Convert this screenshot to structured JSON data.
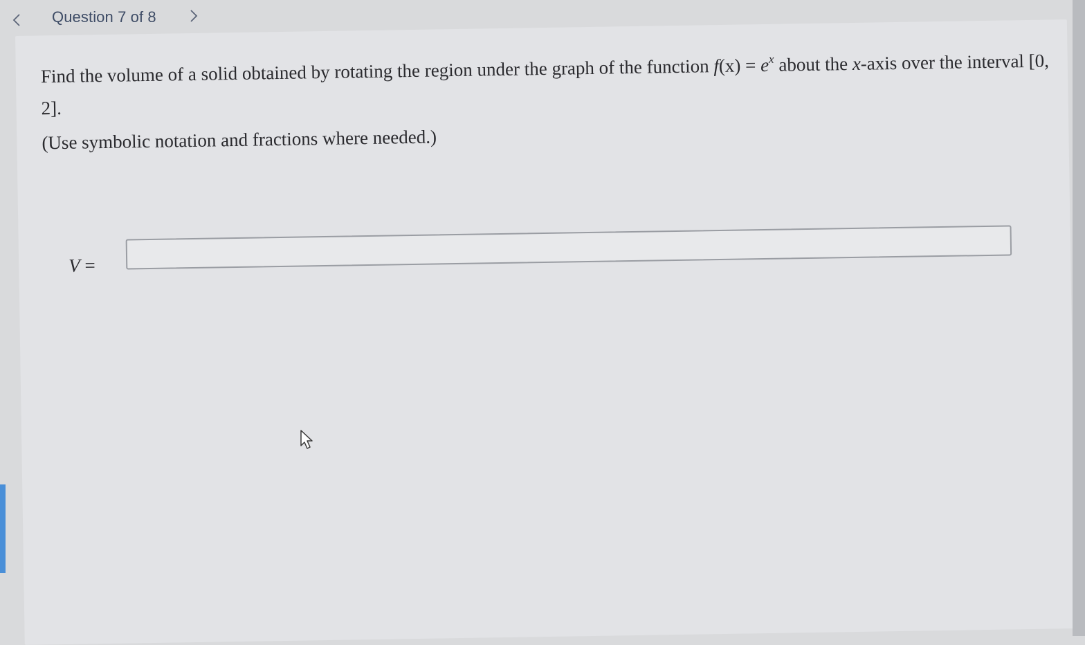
{
  "header": {
    "question_label": "Question 7 of 8",
    "prev_icon": "chevron-left-icon",
    "next_icon": "chevron-right-icon"
  },
  "problem": {
    "text_before": "Find the volume of a solid obtained by rotating the region under the graph of the function ",
    "func": "f",
    "func_arg": "(x)",
    "equals": " = ",
    "base": "e",
    "exponent": "x",
    "text_mid": " about the ",
    "axis_var": "x",
    "text_after": "-axis over the interval [0, 2].",
    "hint": "(Use symbolic notation and fractions where needed.)"
  },
  "answer": {
    "variable": "V",
    "equals": " =",
    "value": ""
  },
  "colors": {
    "background": "#d9dadc",
    "panel": "#e2e3e6",
    "header_text": "#3e4c66",
    "body_text": "#2a2a2e",
    "input_border": "#9a9da3",
    "accent_strip": "#4a8fd8"
  }
}
